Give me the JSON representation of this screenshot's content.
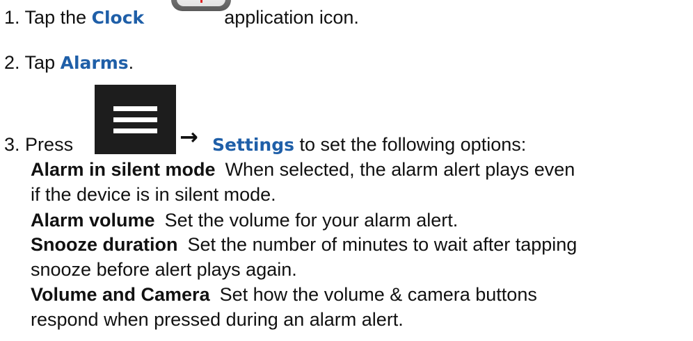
{
  "step1": {
    "number": "1.",
    "pre": "Tap the",
    "keyword": "Clock",
    "post": "application icon."
  },
  "step2": {
    "number": "2.",
    "pre": "Tap",
    "keyword": "Alarms",
    "post": "."
  },
  "step3": {
    "number": "3.",
    "pre": "Press",
    "arrow": "→",
    "keyword": "Settings",
    "post": "to set the following options:"
  },
  "options": [
    {
      "term": "Alarm in silent mode",
      "desc_line1": "When selected, the alarm alert plays even",
      "desc_line2": "if the device is in silent mode."
    },
    {
      "term": "Alarm volume",
      "desc_line1": "Set the volume for your alarm alert."
    },
    {
      "term": "Snooze duration",
      "desc_line1": "Set the number of minutes to wait after tapping",
      "desc_line2": "snooze before alert plays again."
    },
    {
      "term": "Volume and Camera",
      "desc_line1": "Set how the volume & camera buttons",
      "desc_line2": "respond when pressed during an alarm alert."
    }
  ],
  "icons": {
    "clock": "clock-app-icon",
    "menu": "menu-icon",
    "arrow": "right-arrow-icon"
  }
}
